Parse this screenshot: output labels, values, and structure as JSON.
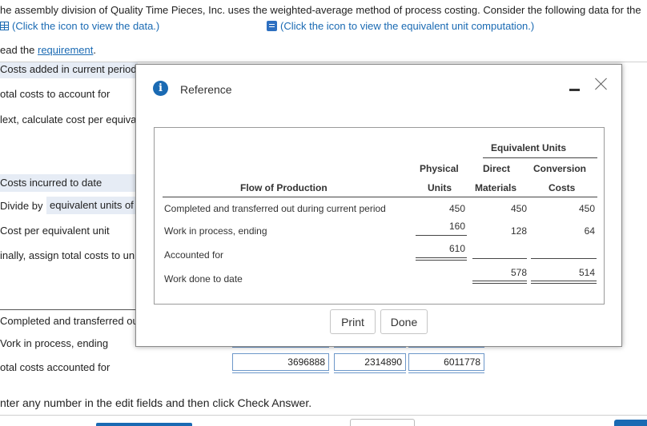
{
  "intro": {
    "text": "he assembly division of Quality Time Pieces, Inc. uses the weighted-average method of process costing. Consider the following data for  the"
  },
  "links": {
    "data_link": "(Click the icon to view the data.)",
    "equiv_link": "(Click the icon to view the equivalent unit computation.)"
  },
  "requirement": {
    "prefix": "ead the ",
    "link": "requirement",
    "suffix": "."
  },
  "background": {
    "costs_added": "Costs added in current period",
    "total_costs": "otal costs to account for",
    "next_calc": "lext, calculate cost per equiva",
    "costs_incurred": "Costs incurred to date",
    "divide_by": "Divide by",
    "equiv_units_of": "equivalent units of",
    "cost_per_eu": "Cost per equivalent unit",
    "finally_assign": "inally, assign total costs to un",
    "completed": "Completed and transferred out",
    "wip_ending": "Vork in process, ending",
    "total_accounted": "otal costs accounted for",
    "totals": [
      "3696888",
      "2314890",
      "6011778"
    ],
    "enter_any": "nter any number in the edit fields and then click Check Answer."
  },
  "modal": {
    "title": "Reference",
    "info_icon": "i",
    "minimize_icon": "minimize-icon",
    "close_icon": "close-icon",
    "table": {
      "group_header": "Equivalent Units",
      "col_physical_1": "Physical",
      "col_physical_2": "Units",
      "col_direct_1": "Direct",
      "col_direct_2": "Materials",
      "col_conv_1": "Conversion",
      "col_conv_2": "Costs",
      "row_header": "Flow of Production",
      "rows": [
        {
          "label": "Completed and transferred out during current period",
          "physical": "450",
          "direct": "450",
          "conversion": "450"
        },
        {
          "label": "Work in process, ending",
          "physical": "160",
          "direct": "128",
          "conversion": "64"
        },
        {
          "label": "Accounted for",
          "physical": "610",
          "direct": "",
          "conversion": ""
        },
        {
          "label": "Work done to date",
          "physical": "",
          "direct": "578",
          "conversion": "514"
        }
      ]
    },
    "buttons": {
      "print": "Print",
      "done": "Done"
    }
  }
}
